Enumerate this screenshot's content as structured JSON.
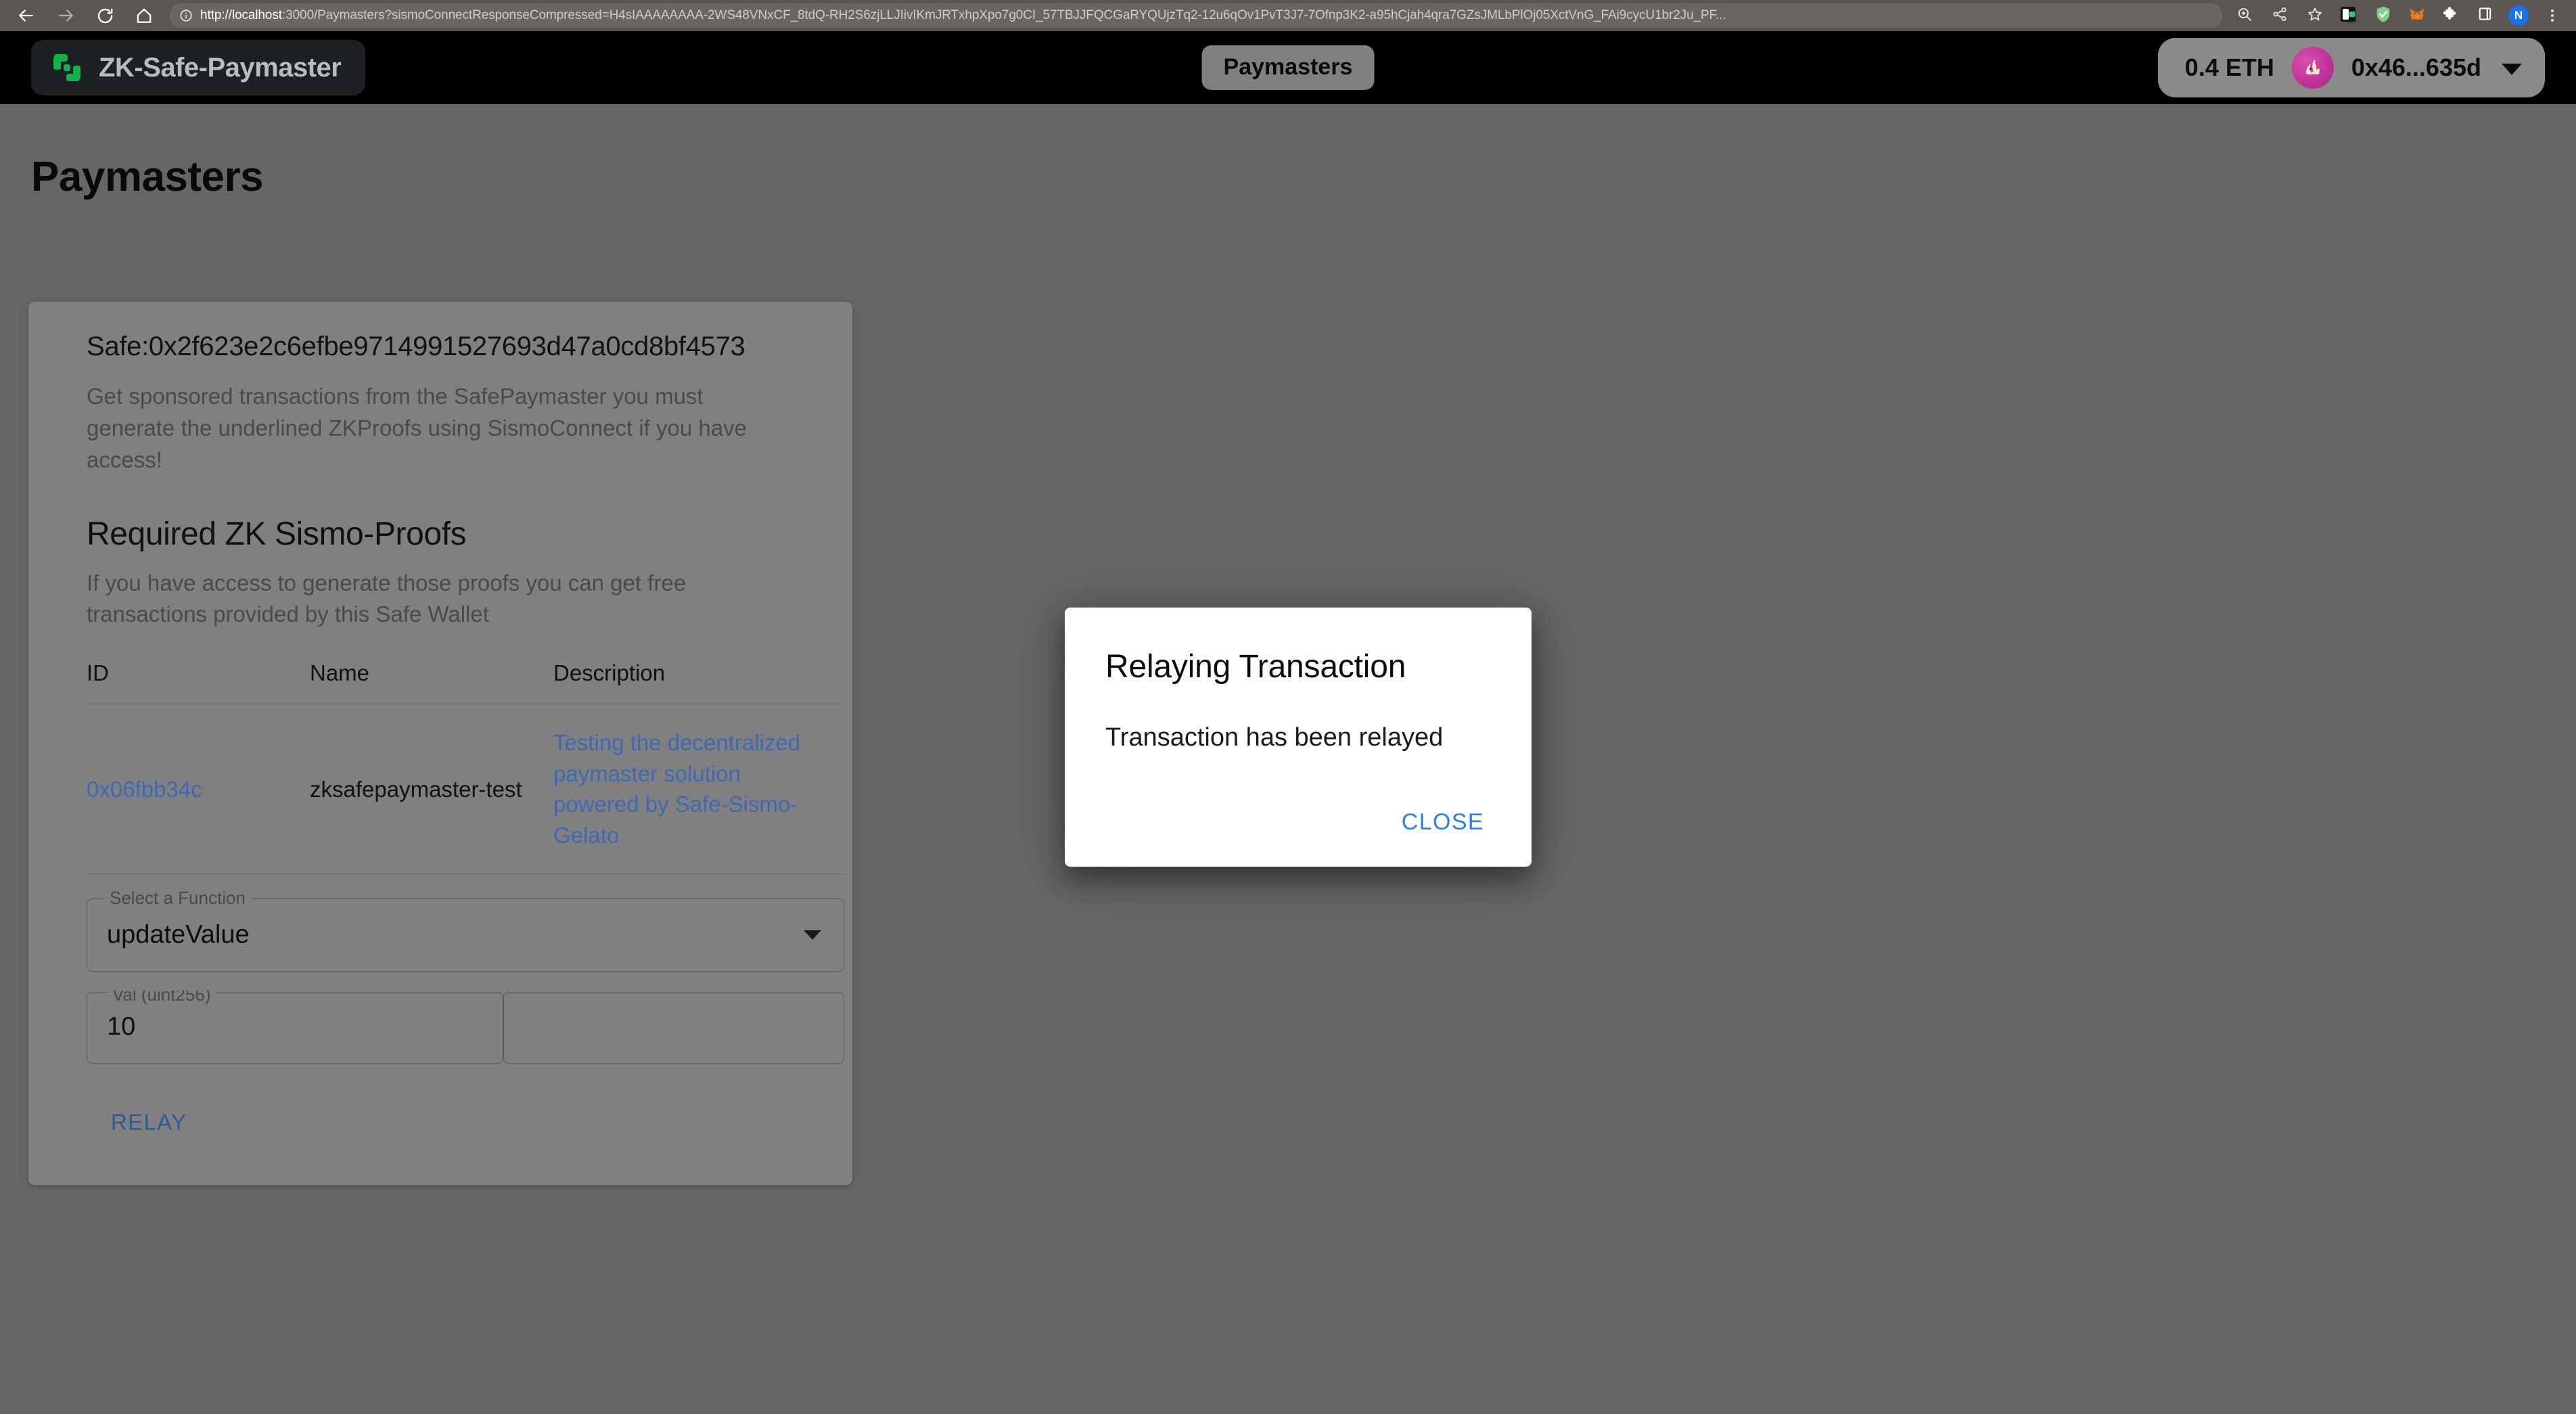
{
  "browser": {
    "back_icon": "arrow-left-icon",
    "forward_icon": "arrow-right-icon",
    "reload_icon": "reload-icon",
    "home_icon": "home-icon",
    "site_info_icon": "info-circle-icon",
    "url_host": "http://localhost",
    "url_rest": ":3000/Paymasters?sismoConnectResponseCompressed=H4sIAAAAAAAA-2WS48VNxCF_8tdQ-RH2S6zjLLJIivIKmJRTxhpXpo7g0CI_57TBJJFQCGaRYQUjzTq2-12u6qOv1PvT3J7-7Ofnp3K2-a95hCjah4qra7GZsJMLbPlOj05XctVnG_FAi9cycU1br2Ju_PF...",
    "zoom_icon": "magnifier-icon",
    "share_icon": "share-icon",
    "bookmark_icon": "star-icon",
    "extension_icon": "puzzle-extension-icon",
    "adblock_icon": "shield-check-icon",
    "metamask_icon": "metamask-fox-icon",
    "extensions_icon": "puzzle-icon",
    "sidepanel_icon": "side-panel-icon",
    "profile_initial": "N",
    "menu_icon": "three-dot-menu-icon"
  },
  "app_header": {
    "brand_name": "ZK-Safe-Paymaster",
    "brand_logo_icon": "safe-logo-icon",
    "nav_chip": "Paymasters",
    "account": {
      "balance": "0.4 ETH",
      "avatar_icon": "unicorn-avatar-icon",
      "address": "0x46...635d",
      "chevron_icon": "chevron-down-icon"
    }
  },
  "page": {
    "title": "Paymasters"
  },
  "card": {
    "safe_title": "Safe:0x2f623e2c6efbe9714991527693d47a0cd8bf4573",
    "safe_desc": "Get sponsored transactions from the SafePaymaster you must generate the underlined ZKProofs using SismoConnect if you have access!",
    "section_title": "Required ZK Sismo-Proofs",
    "section_desc": "If you have access to generate those proofs you can get free transactions provided by this Safe Wallet",
    "table": {
      "headers": [
        "ID",
        "Name",
        "Description"
      ],
      "rows": [
        {
          "id": "0x06fbb34c",
          "name": "zksafepaymaster-test",
          "description": "Testing the decentralized paymaster solution powered by Safe-Sismo-Gelato"
        }
      ]
    },
    "function_field": {
      "label": "Select a Function",
      "value": "updateValue",
      "arrow_icon": "select-arrow-icon"
    },
    "param_field": {
      "label": "Val (uint256)",
      "value": "10"
    },
    "relay_label": "RELAY"
  },
  "modal": {
    "title": "Relaying Transaction",
    "body": "Transaction has been relayed",
    "close_label": "CLOSE"
  },
  "colors": {
    "page_bg": "#666666",
    "card_bg": "#808080",
    "header_bg": "#000000",
    "brand_green": "#12ff80",
    "link_blue": "#3f68b5",
    "modal_link_blue": "#2f7df6",
    "browser_chrome": "#5c5653"
  }
}
